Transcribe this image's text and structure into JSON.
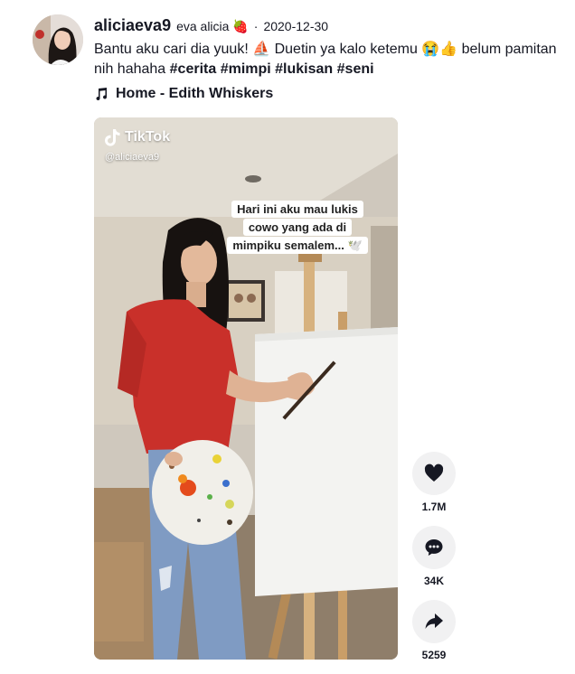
{
  "post": {
    "username": "aliciaeva9",
    "nickname": "eva alicia",
    "nickname_emoji": "🍓",
    "separator": "·",
    "date": "2020-12-30",
    "caption": {
      "part1": "Bantu aku cari dia yuuk! ",
      "emoji1": "⛵",
      "part2": " Duetin ya kalo ketemu ",
      "emoji2": "😭👍",
      "part3": " belum pamitan nih hahaha ",
      "tags": [
        "#cerita",
        "#mimpi",
        "#lukisan",
        "#seni"
      ]
    },
    "music": "Home - Edith Whiskers"
  },
  "video": {
    "brand": "TikTok",
    "handle": "@aliciaeva9",
    "subtitle_lines": [
      "Hari ini aku mau lukis",
      "cowo yang ada di",
      "mimpiku semalem... 🕊️"
    ]
  },
  "actions": {
    "likes": "1.7M",
    "comments": "34K",
    "shares": "5259"
  },
  "icons": [
    "music-note-icon",
    "tiktok-logo-icon",
    "heart-icon",
    "comment-icon",
    "share-icon"
  ]
}
